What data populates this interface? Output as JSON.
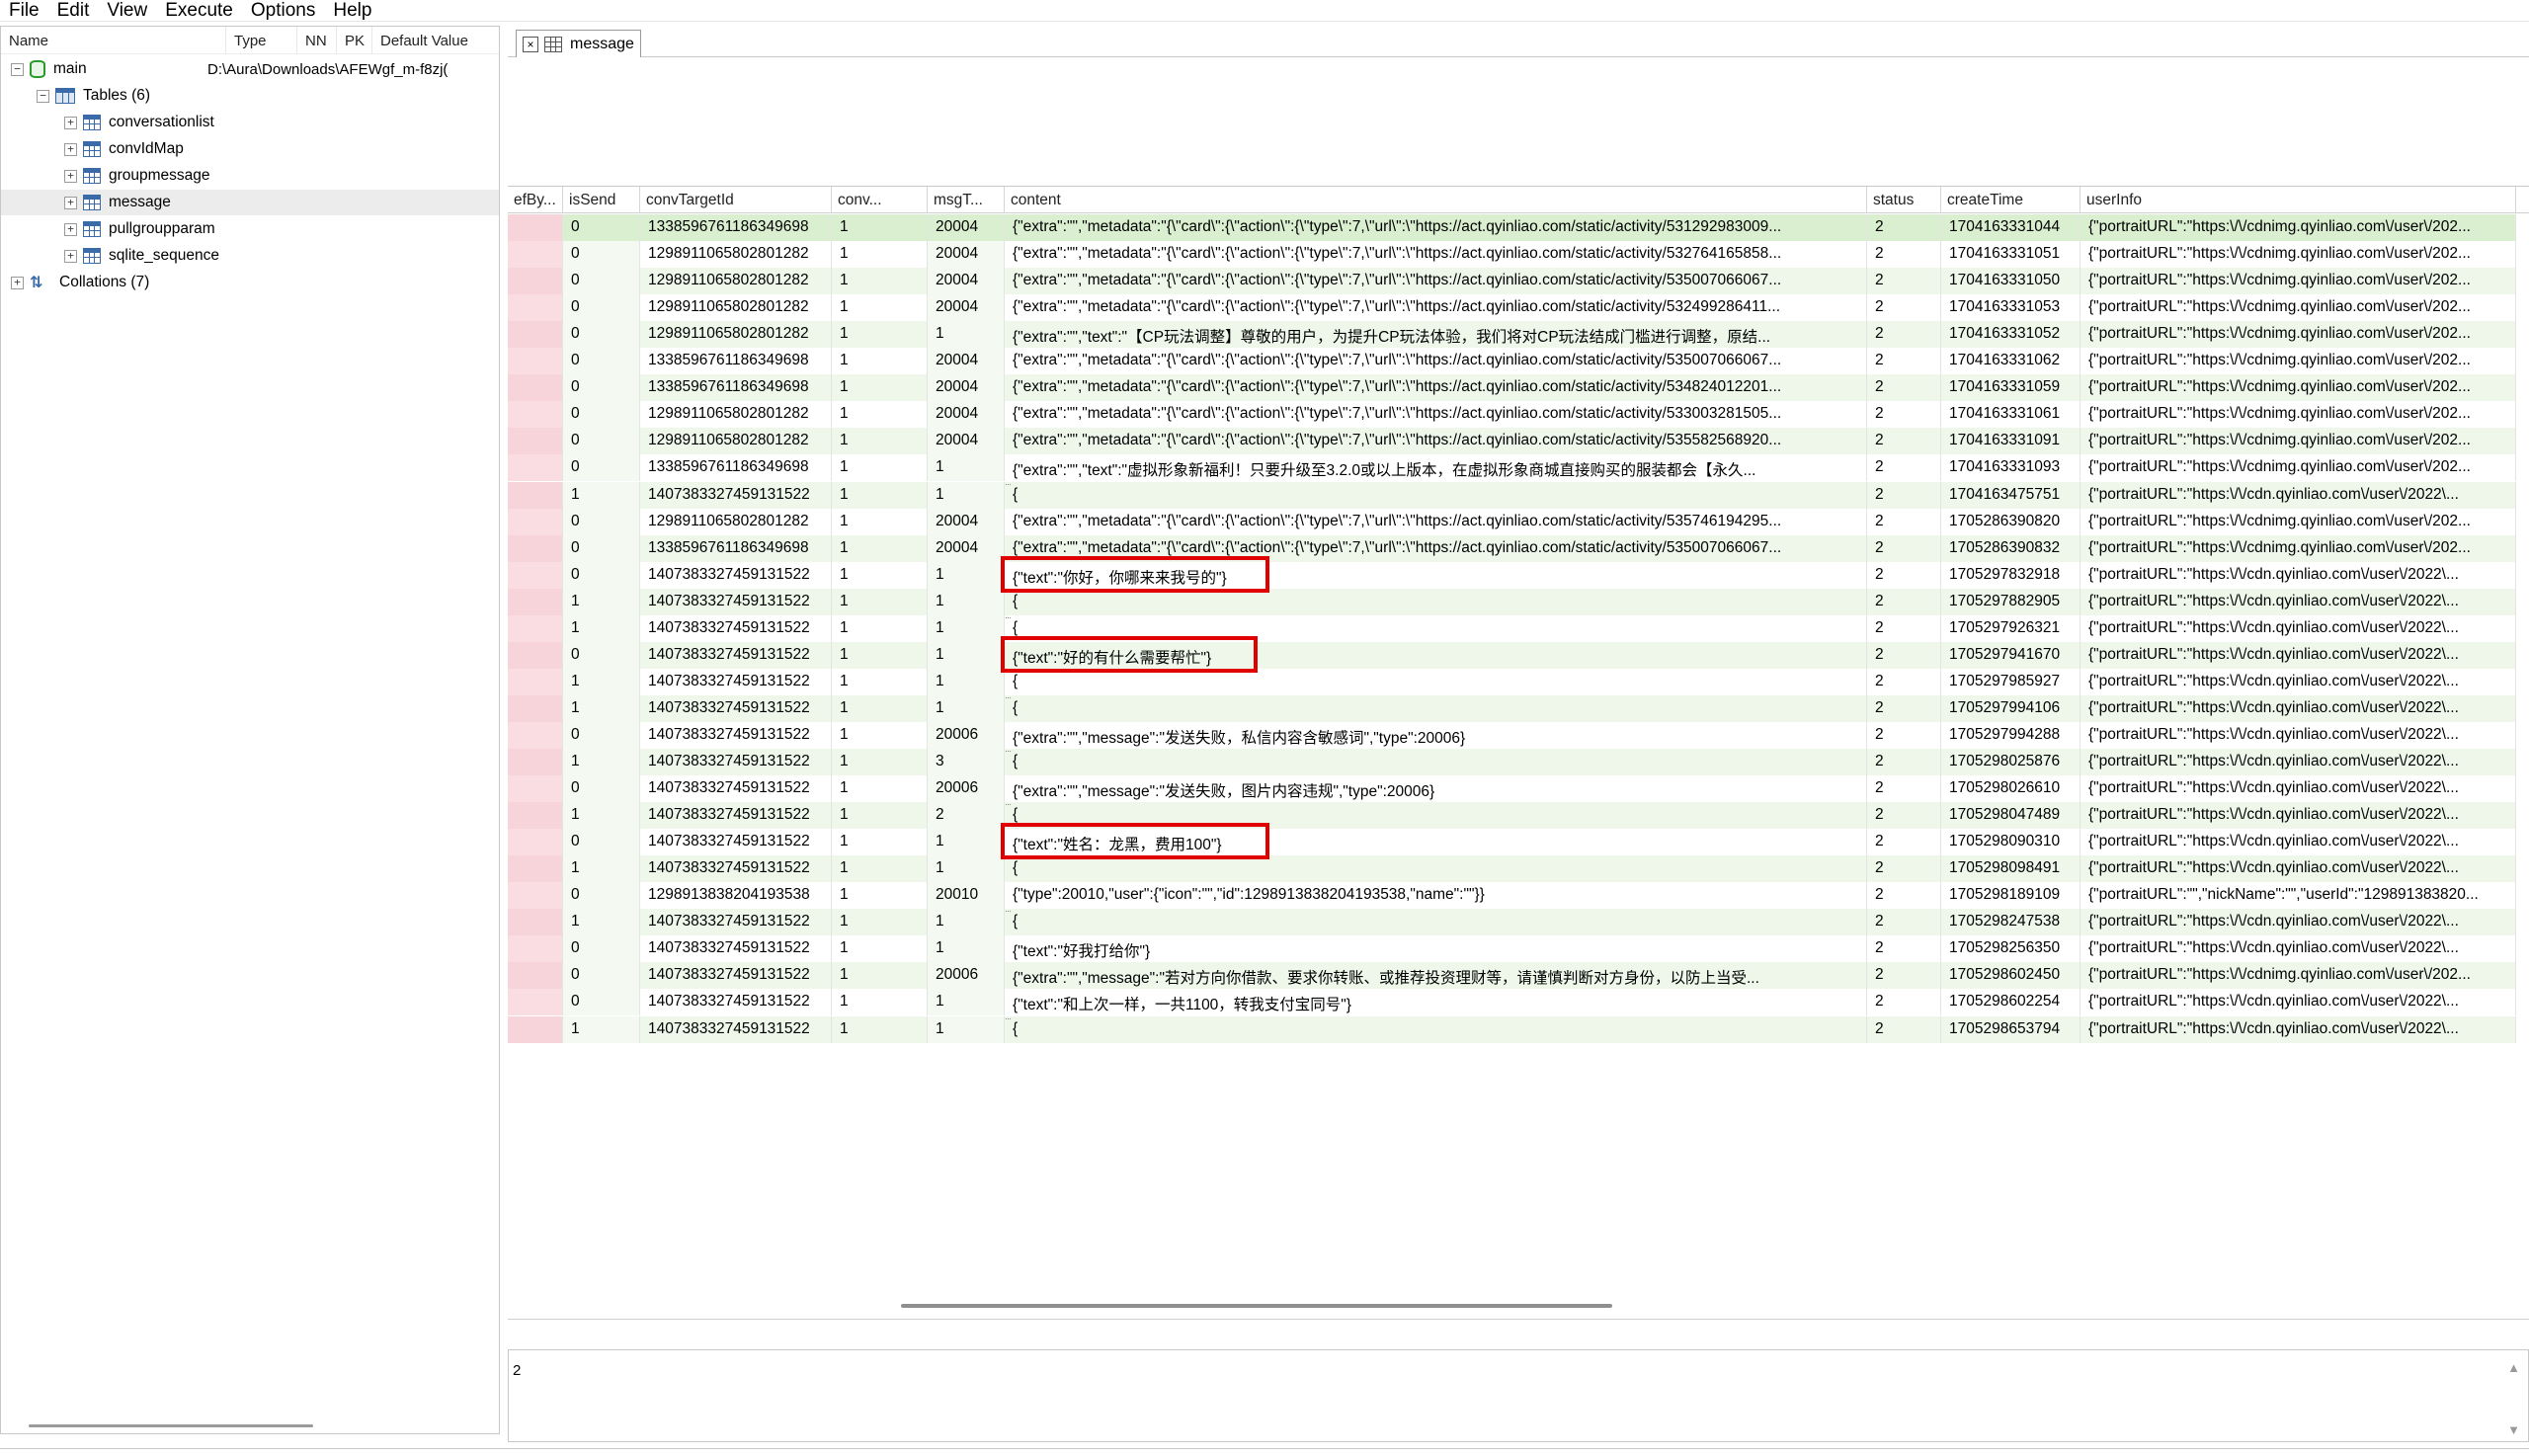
{
  "menu": [
    "File",
    "Edit",
    "View",
    "Execute",
    "Options",
    "Help"
  ],
  "tree": {
    "header": {
      "name": "Name",
      "type": "Type",
      "nn": "NN",
      "pk": "PK",
      "default": "Default Value"
    },
    "db": {
      "name": "main",
      "path": "D:\\Aura\\Downloads\\AFEWgf_m-f8zj("
    },
    "tables_label": "Tables (6)",
    "tables": [
      "conversationlist",
      "convIdMap",
      "groupmessage",
      "message",
      "pullgroupparam",
      "sqlite_sequence"
    ],
    "selected_table": "message",
    "collations_label": "Collations (7)"
  },
  "tab": {
    "label": "message"
  },
  "grid": {
    "columns": [
      "efBy...",
      "isSend",
      "convTargetId",
      "conv...",
      "msgT...",
      "content",
      "status",
      "createTime",
      "userInfo"
    ],
    "rows": [
      [
        "",
        "0",
        "1338596761186349698",
        "1",
        "20004",
        "{\"extra\":\"\",\"metadata\":\"{\\\"card\\\":{\\\"action\\\":{\\\"type\\\":7,\\\"url\\\":\\\"https://act.qyinliao.com/static/activity/531292983009...",
        "2",
        "1704163331044",
        "{\"portraitURL\":\"https:\\/\\/cdnimg.qyinliao.com\\/user\\/202..."
      ],
      [
        "",
        "0",
        "1298911065802801282",
        "1",
        "20004",
        "{\"extra\":\"\",\"metadata\":\"{\\\"card\\\":{\\\"action\\\":{\\\"type\\\":7,\\\"url\\\":\\\"https://act.qyinliao.com/static/activity/532764165858...",
        "2",
        "1704163331051",
        "{\"portraitURL\":\"https:\\/\\/cdnimg.qyinliao.com\\/user\\/202..."
      ],
      [
        "",
        "0",
        "1298911065802801282",
        "1",
        "20004",
        "{\"extra\":\"\",\"metadata\":\"{\\\"card\\\":{\\\"action\\\":{\\\"type\\\":7,\\\"url\\\":\\\"https://act.qyinliao.com/static/activity/535007066067...",
        "2",
        "1704163331050",
        "{\"portraitURL\":\"https:\\/\\/cdnimg.qyinliao.com\\/user\\/202..."
      ],
      [
        "",
        "0",
        "1298911065802801282",
        "1",
        "20004",
        "{\"extra\":\"\",\"metadata\":\"{\\\"card\\\":{\\\"action\\\":{\\\"type\\\":7,\\\"url\\\":\\\"https://act.qyinliao.com/static/activity/532499286411...",
        "2",
        "1704163331053",
        "{\"portraitURL\":\"https:\\/\\/cdnimg.qyinliao.com\\/user\\/202..."
      ],
      [
        "",
        "0",
        "1298911065802801282",
        "1",
        "1",
        "{\"extra\":\"\",\"text\":\"【CP玩法调整】尊敬的用户，为提升CP玩法体验，我们将对CP玩法结成门槛进行调整，原结...",
        "2",
        "1704163331052",
        "{\"portraitURL\":\"https:\\/\\/cdnimg.qyinliao.com\\/user\\/202..."
      ],
      [
        "",
        "0",
        "1338596761186349698",
        "1",
        "20004",
        "{\"extra\":\"\",\"metadata\":\"{\\\"card\\\":{\\\"action\\\":{\\\"type\\\":7,\\\"url\\\":\\\"https://act.qyinliao.com/static/activity/535007066067...",
        "2",
        "1704163331062",
        "{\"portraitURL\":\"https:\\/\\/cdnimg.qyinliao.com\\/user\\/202..."
      ],
      [
        "",
        "0",
        "1338596761186349698",
        "1",
        "20004",
        "{\"extra\":\"\",\"metadata\":\"{\\\"card\\\":{\\\"action\\\":{\\\"type\\\":7,\\\"url\\\":\\\"https://act.qyinliao.com/static/activity/534824012201...",
        "2",
        "1704163331059",
        "{\"portraitURL\":\"https:\\/\\/cdnimg.qyinliao.com\\/user\\/202..."
      ],
      [
        "",
        "0",
        "1298911065802801282",
        "1",
        "20004",
        "{\"extra\":\"\",\"metadata\":\"{\\\"card\\\":{\\\"action\\\":{\\\"type\\\":7,\\\"url\\\":\\\"https://act.qyinliao.com/static/activity/533003281505...",
        "2",
        "1704163331061",
        "{\"portraitURL\":\"https:\\/\\/cdnimg.qyinliao.com\\/user\\/202..."
      ],
      [
        "",
        "0",
        "1298911065802801282",
        "1",
        "20004",
        "{\"extra\":\"\",\"metadata\":\"{\\\"card\\\":{\\\"action\\\":{\\\"type\\\":7,\\\"url\\\":\\\"https://act.qyinliao.com/static/activity/535582568920...",
        "2",
        "1704163331091",
        "{\"portraitURL\":\"https:\\/\\/cdnimg.qyinliao.com\\/user\\/202..."
      ],
      [
        "",
        "0",
        "1338596761186349698",
        "1",
        "1",
        "{\"extra\":\"\",\"text\":\"虚拟形象新福利！只要升级至3.2.0或以上版本，在虚拟形象商城直接购买的服装都会【永久...",
        "2",
        "1704163331093",
        "{\"portraitURL\":\"https:\\/\\/cdnimg.qyinliao.com\\/user\\/202..."
      ],
      [
        "",
        "1",
        "1407383327459131522",
        "1",
        "1",
        "{",
        "2",
        "1704163475751",
        "{\"portraitURL\":\"https:\\/\\/cdn.qyinliao.com\\/user\\/2022\\..."
      ],
      [
        "",
        "0",
        "1298911065802801282",
        "1",
        "20004",
        "{\"extra\":\"\",\"metadata\":\"{\\\"card\\\":{\\\"action\\\":{\\\"type\\\":7,\\\"url\\\":\\\"https://act.qyinliao.com/static/activity/535746194295...",
        "2",
        "1705286390820",
        "{\"portraitURL\":\"https:\\/\\/cdnimg.qyinliao.com\\/user\\/202..."
      ],
      [
        "",
        "0",
        "1338596761186349698",
        "1",
        "20004",
        "{\"extra\":\"\",\"metadata\":\"{\\\"card\\\":{\\\"action\\\":{\\\"type\\\":7,\\\"url\\\":\\\"https://act.qyinliao.com/static/activity/535007066067...",
        "2",
        "1705286390832",
        "{\"portraitURL\":\"https:\\/\\/cdnimg.qyinliao.com\\/user\\/202..."
      ],
      [
        "",
        "0",
        "1407383327459131522",
        "1",
        "1",
        "{\"text\":\"你好，你哪来来我号的\"}",
        "2",
        "1705297832918",
        "{\"portraitURL\":\"https:\\/\\/cdn.qyinliao.com\\/user\\/2022\\..."
      ],
      [
        "",
        "1",
        "1407383327459131522",
        "1",
        "1",
        "{",
        "2",
        "1705297882905",
        "{\"portraitURL\":\"https:\\/\\/cdn.qyinliao.com\\/user\\/2022\\..."
      ],
      [
        "",
        "1",
        "1407383327459131522",
        "1",
        "1",
        "{",
        "2",
        "1705297926321",
        "{\"portraitURL\":\"https:\\/\\/cdn.qyinliao.com\\/user\\/2022\\..."
      ],
      [
        "",
        "0",
        "1407383327459131522",
        "1",
        "1",
        "{\"text\":\"好的有什么需要帮忙\"}",
        "2",
        "1705297941670",
        "{\"portraitURL\":\"https:\\/\\/cdn.qyinliao.com\\/user\\/2022\\..."
      ],
      [
        "",
        "1",
        "1407383327459131522",
        "1",
        "1",
        "{",
        "2",
        "1705297985927",
        "{\"portraitURL\":\"https:\\/\\/cdn.qyinliao.com\\/user\\/2022\\..."
      ],
      [
        "",
        "1",
        "1407383327459131522",
        "1",
        "1",
        "{",
        "2",
        "1705297994106",
        "{\"portraitURL\":\"https:\\/\\/cdn.qyinliao.com\\/user\\/2022\\..."
      ],
      [
        "",
        "0",
        "1407383327459131522",
        "1",
        "20006",
        "{\"extra\":\"\",\"message\":\"发送失败，私信内容含敏感词\",\"type\":20006}",
        "2",
        "1705297994288",
        "{\"portraitURL\":\"https:\\/\\/cdn.qyinliao.com\\/user\\/2022\\..."
      ],
      [
        "",
        "1",
        "1407383327459131522",
        "1",
        "3",
        "{",
        "2",
        "1705298025876",
        "{\"portraitURL\":\"https:\\/\\/cdn.qyinliao.com\\/user\\/2022\\..."
      ],
      [
        "",
        "0",
        "1407383327459131522",
        "1",
        "20006",
        "{\"extra\":\"\",\"message\":\"发送失败，图片内容违规\",\"type\":20006}",
        "2",
        "1705298026610",
        "{\"portraitURL\":\"https:\\/\\/cdn.qyinliao.com\\/user\\/2022\\..."
      ],
      [
        "",
        "1",
        "1407383327459131522",
        "1",
        "2",
        "{",
        "2",
        "1705298047489",
        "{\"portraitURL\":\"https:\\/\\/cdn.qyinliao.com\\/user\\/2022\\..."
      ],
      [
        "",
        "0",
        "1407383327459131522",
        "1",
        "1",
        "{\"text\":\"姓名：龙黑，费用100\"}",
        "2",
        "1705298090310",
        "{\"portraitURL\":\"https:\\/\\/cdn.qyinliao.com\\/user\\/2022\\..."
      ],
      [
        "",
        "1",
        "1407383327459131522",
        "1",
        "1",
        "{",
        "2",
        "1705298098491",
        "{\"portraitURL\":\"https:\\/\\/cdn.qyinliao.com\\/user\\/2022\\..."
      ],
      [
        "",
        "0",
        "1298913838204193538",
        "1",
        "20010",
        "{\"type\":20010,\"user\":{\"icon\":\"\",\"id\":1298913838204193538,\"name\":\"\"}}",
        "2",
        "1705298189109",
        "{\"portraitURL\":\"\",\"nickName\":\"\",\"userId\":\"129891383820..."
      ],
      [
        "",
        "1",
        "1407383327459131522",
        "1",
        "1",
        "{",
        "2",
        "1705298247538",
        "{\"portraitURL\":\"https:\\/\\/cdn.qyinliao.com\\/user\\/2022\\..."
      ],
      [
        "",
        "0",
        "1407383327459131522",
        "1",
        "1",
        "{\"text\":\"好我打给你\"}",
        "2",
        "1705298256350",
        "{\"portraitURL\":\"https:\\/\\/cdn.qyinliao.com\\/user\\/2022\\..."
      ],
      [
        "",
        "0",
        "1407383327459131522",
        "1",
        "20006",
        "{\"extra\":\"\",\"message\":\"若对方向你借款、要求你转账、或推荐投资理财等，请谨慎判断对方身份，以防上当受...",
        "2",
        "1705298602450",
        "{\"portraitURL\":\"https:\\/\\/cdnimg.qyinliao.com\\/user\\/202..."
      ],
      [
        "",
        "0",
        "1407383327459131522",
        "1",
        "1",
        "{\"text\":\"和上次一样，一共1100，转我支付宝同号\"}",
        "2",
        "1705298602254",
        "{\"portraitURL\":\"https:\\/\\/cdn.qyinliao.com\\/user\\/2022\\..."
      ],
      [
        "",
        "1",
        "1407383327459131522",
        "1",
        "1",
        "{",
        "2",
        "1705298653794",
        "{\"portraitURL\":\"https:\\/\\/cdn.qyinliao.com\\/user\\/2022\\..."
      ]
    ],
    "highlighted_rows": [
      13,
      16,
      23
    ]
  },
  "editor": {
    "value": "2"
  }
}
